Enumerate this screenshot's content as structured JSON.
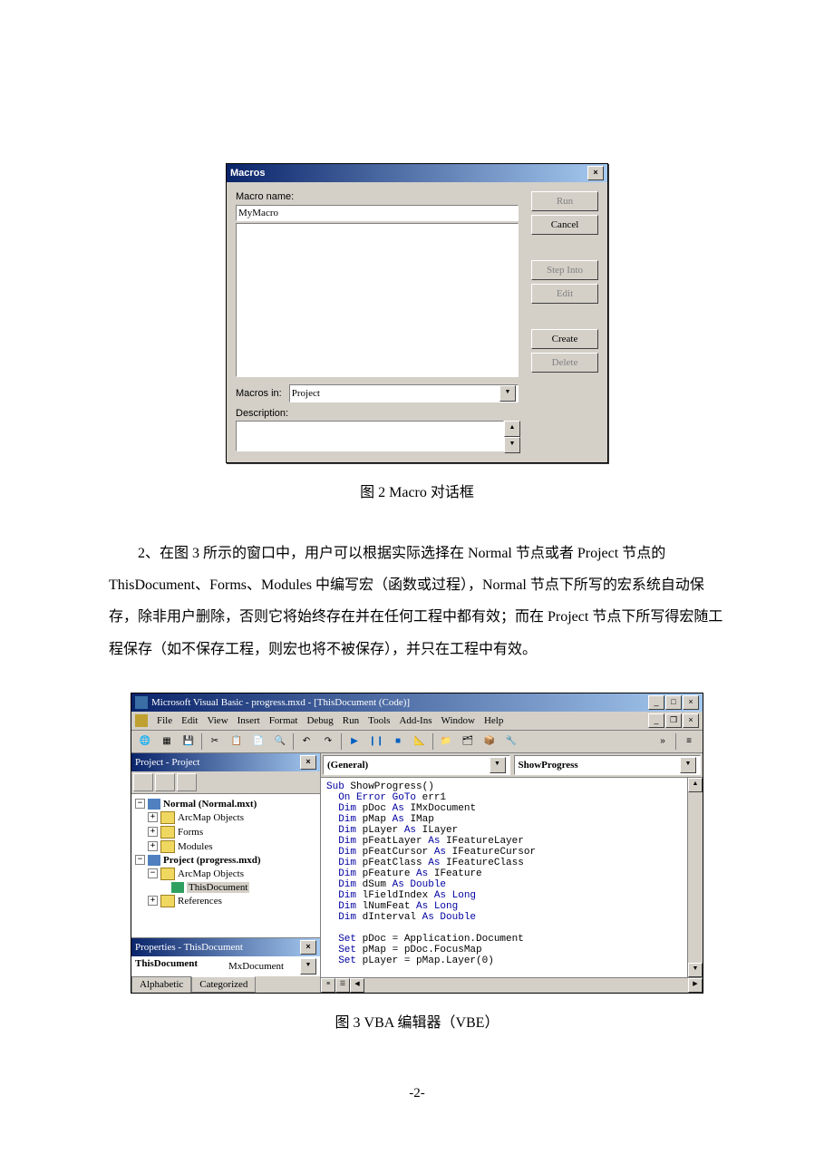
{
  "macros_dialog": {
    "title": "Macros",
    "macro_name_label": "Macro name:",
    "macro_name_value": "MyMacro",
    "macros_in_label": "Macros in:",
    "macros_in_value": "Project",
    "description_label": "Description:",
    "buttons": {
      "run": "Run",
      "cancel": "Cancel",
      "step_into": "Step Into",
      "edit": "Edit",
      "create": "Create",
      "delete": "Delete"
    }
  },
  "fig2_caption": "图 2 Macro 对话框",
  "body_paragraph": "2、在图 3 所示的窗口中，用户可以根据实际选择在 Normal 节点或者 Project 节点的 ThisDocument、Forms、Modules 中编写宏（函数或过程），Normal 节点下所写的宏系统自动保存，除非用户删除，否则它将始终存在并在任何工程中都有效；而在 Project 节点下所写得宏随工程保存（如不保存工程，则宏也将不被保存），并只在工程中有效。",
  "vbe": {
    "title": "Microsoft Visual Basic - progress.mxd - [ThisDocument (Code)]",
    "menus": [
      "File",
      "Edit",
      "View",
      "Insert",
      "Format",
      "Debug",
      "Run",
      "Tools",
      "Add-Ins",
      "Window",
      "Help"
    ],
    "project_panel_title": "Project - Project",
    "tree": {
      "normal": "Normal (Normal.mxt)",
      "arcmap_objects": "ArcMap Objects",
      "forms": "Forms",
      "modules": "Modules",
      "project": "Project (progress.mxd)",
      "this_document": "ThisDocument",
      "references": "References"
    },
    "properties_panel_title": "Properties - ThisDocument",
    "prop_name": "ThisDocument",
    "prop_type": "MxDocument",
    "tab_alphabetic": "Alphabetic",
    "tab_categorized": "Categorized",
    "code_left_select": "(General)",
    "code_right_select": "ShowProgress",
    "code_lines": [
      {
        "t": "kw",
        "s": "Sub "
      },
      {
        "t": "",
        "s": "ShowProgress()\n"
      },
      {
        "t": "kw",
        "s": "  On Error GoTo "
      },
      {
        "t": "",
        "s": "err1\n"
      },
      {
        "t": "kw",
        "s": "  Dim "
      },
      {
        "t": "",
        "s": "pDoc "
      },
      {
        "t": "kw",
        "s": "As "
      },
      {
        "t": "",
        "s": "IMxDocument\n"
      },
      {
        "t": "kw",
        "s": "  Dim "
      },
      {
        "t": "",
        "s": "pMap "
      },
      {
        "t": "kw",
        "s": "As "
      },
      {
        "t": "",
        "s": "IMap\n"
      },
      {
        "t": "kw",
        "s": "  Dim "
      },
      {
        "t": "",
        "s": "pLayer "
      },
      {
        "t": "kw",
        "s": "As "
      },
      {
        "t": "",
        "s": "ILayer\n"
      },
      {
        "t": "kw",
        "s": "  Dim "
      },
      {
        "t": "",
        "s": "pFeatLayer "
      },
      {
        "t": "kw",
        "s": "As "
      },
      {
        "t": "",
        "s": "IFeatureLayer\n"
      },
      {
        "t": "kw",
        "s": "  Dim "
      },
      {
        "t": "",
        "s": "pFeatCursor "
      },
      {
        "t": "kw",
        "s": "As "
      },
      {
        "t": "",
        "s": "IFeatureCursor\n"
      },
      {
        "t": "kw",
        "s": "  Dim "
      },
      {
        "t": "",
        "s": "pFeatClass "
      },
      {
        "t": "kw",
        "s": "As "
      },
      {
        "t": "",
        "s": "IFeatureClass\n"
      },
      {
        "t": "kw",
        "s": "  Dim "
      },
      {
        "t": "",
        "s": "pFeature "
      },
      {
        "t": "kw",
        "s": "As "
      },
      {
        "t": "",
        "s": "IFeature\n"
      },
      {
        "t": "kw",
        "s": "  Dim "
      },
      {
        "t": "",
        "s": "dSum "
      },
      {
        "t": "kw",
        "s": "As Double\n"
      },
      {
        "t": "kw",
        "s": "  Dim "
      },
      {
        "t": "",
        "s": "lFieldIndex "
      },
      {
        "t": "kw",
        "s": "As Long\n"
      },
      {
        "t": "kw",
        "s": "  Dim "
      },
      {
        "t": "",
        "s": "lNumFeat "
      },
      {
        "t": "kw",
        "s": "As Long\n"
      },
      {
        "t": "kw",
        "s": "  Dim "
      },
      {
        "t": "",
        "s": "dInterval "
      },
      {
        "t": "kw",
        "s": "As Double\n\n"
      },
      {
        "t": "kw",
        "s": "  Set "
      },
      {
        "t": "",
        "s": "pDoc = Application.Document\n"
      },
      {
        "t": "kw",
        "s": "  Set "
      },
      {
        "t": "",
        "s": "pMap = pDoc.FocusMap\n"
      },
      {
        "t": "kw",
        "s": "  Set "
      },
      {
        "t": "",
        "s": "pLayer = pMap.Layer(0)"
      }
    ]
  },
  "fig3_caption": "图 3 VBA 编辑器（VBE）",
  "page_number": "-2-"
}
